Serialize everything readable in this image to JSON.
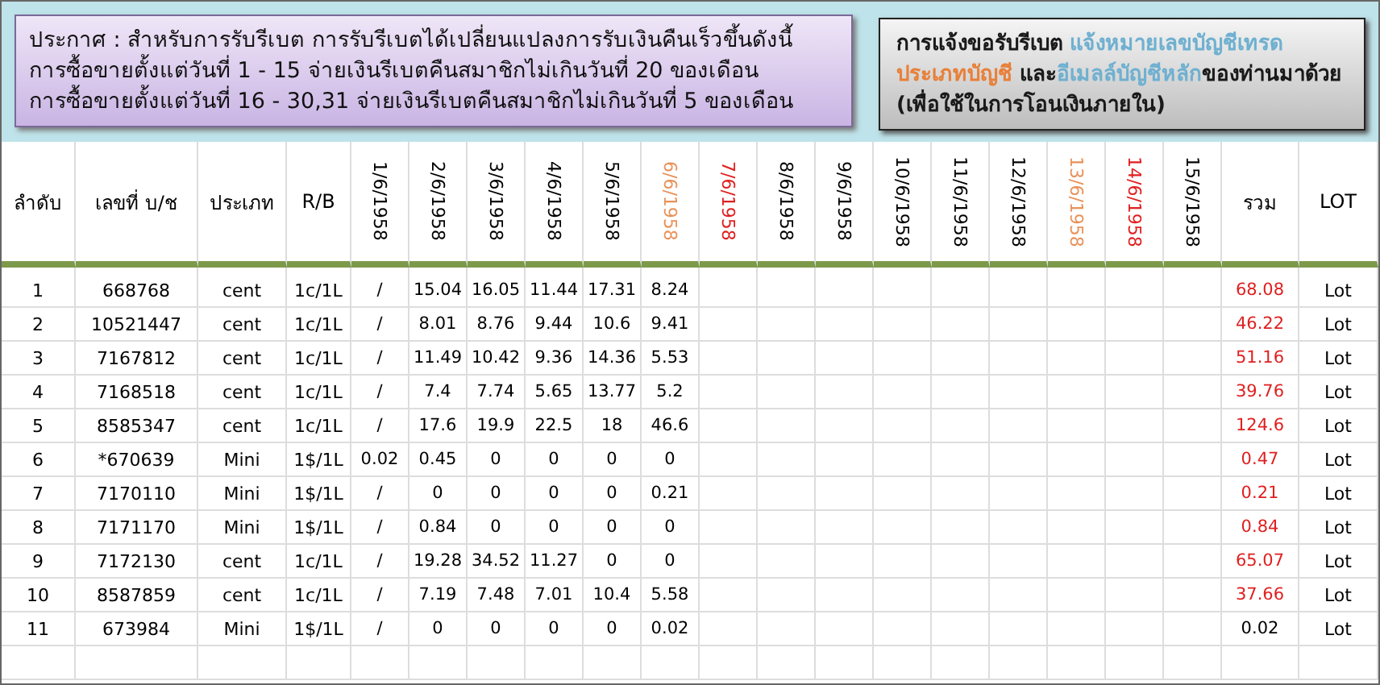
{
  "notice": {
    "lines": [
      "ประกาศ : สำหรับการรับรีเบต  การรับรีเบตได้เปลี่ยนแปลงการรับเงินคืนเร็วขึ้นดังนี้",
      "การซื้อขายตั้งแต่วันที่   1 - 15  จ่ายเงินรีเบตคืนสมาชิกไม่เกินวันที่ 20 ของเดือน",
      "การซื้อขายตั้งแต่วันที่ 16 - 30,31 จ่ายเงินรีเบตคืนสมาชิกไม่เกินวันที่  5  ของเดือน"
    ]
  },
  "request_note": {
    "segments": [
      {
        "text": "การแจ้งขอรับรีเบต  ",
        "color": "#1a1a1a"
      },
      {
        "text": "แจ้งหมายเลขบัญชีเทรด",
        "color": "#6fb0d0"
      },
      {
        "text": " ประเภทบัญชี",
        "color": "#e8803a"
      },
      {
        "text": " และ",
        "color": "#1a1a1a"
      },
      {
        "text": "อีเมลล์บัญชีหลัก",
        "color": "#6fb0d0"
      },
      {
        "text": "ของท่านมาด้วย   (เพื่อใช้ในการโอนเงินภายใน)",
        "color": "#1a1a1a"
      }
    ]
  },
  "table": {
    "columns": [
      "ลำดับ",
      "เลขที่ บ/ช",
      "ประเภท",
      "R/B"
    ],
    "date_columns": [
      {
        "label": "1/6/1958",
        "color": "#000000"
      },
      {
        "label": "2/6/1958",
        "color": "#000000"
      },
      {
        "label": "3/6/1958",
        "color": "#000000"
      },
      {
        "label": "4/6/1958",
        "color": "#000000"
      },
      {
        "label": "5/6/1958",
        "color": "#000000"
      },
      {
        "label": "6/6/1958",
        "color": "#e8925a"
      },
      {
        "label": "7/6/1958",
        "color": "#e02020"
      },
      {
        "label": "8/6/1958",
        "color": "#000000"
      },
      {
        "label": "9/6/1958",
        "color": "#000000"
      },
      {
        "label": "10/6/1958",
        "color": "#000000"
      },
      {
        "label": "11/6/1958",
        "color": "#000000"
      },
      {
        "label": "12/6/1958",
        "color": "#000000"
      },
      {
        "label": "13/6/1958",
        "color": "#e8925a"
      },
      {
        "label": "14/6/1958",
        "color": "#e02020"
      },
      {
        "label": "15/6/1958",
        "color": "#000000"
      }
    ],
    "total_column": "รวม",
    "lot_column": "LOT",
    "rows": [
      {
        "no": "1",
        "account": "668768",
        "type": "cent",
        "rb": "1c/1L",
        "values": [
          "/",
          "15.04",
          "16.05",
          "11.44",
          "17.31",
          "8.24"
        ],
        "total": {
          "text": "68.08",
          "color": "#e02020"
        },
        "lot": "Lot"
      },
      {
        "no": "2",
        "account": "10521447",
        "type": "cent",
        "rb": "1c/1L",
        "values": [
          "/",
          "8.01",
          "8.76",
          "9.44",
          "10.6",
          "9.41"
        ],
        "total": {
          "text": "46.22",
          "color": "#e02020"
        },
        "lot": "Lot"
      },
      {
        "no": "3",
        "account": "7167812",
        "type": "cent",
        "rb": "1c/1L",
        "values": [
          "/",
          "11.49",
          "10.42",
          "9.36",
          "14.36",
          "5.53"
        ],
        "total": {
          "text": "51.16",
          "color": "#e02020"
        },
        "lot": "Lot"
      },
      {
        "no": "4",
        "account": "7168518",
        "type": "cent",
        "rb": "1c/1L",
        "values": [
          "/",
          "7.4",
          "7.74",
          "5.65",
          "13.77",
          "5.2"
        ],
        "total": {
          "text": "39.76",
          "color": "#e02020"
        },
        "lot": "Lot"
      },
      {
        "no": "5",
        "account": "8585347",
        "type": "cent",
        "rb": "1c/1L",
        "values": [
          "/",
          "17.6",
          "19.9",
          "22.5",
          "18",
          "46.6"
        ],
        "total": {
          "text": "124.6",
          "color": "#e02020"
        },
        "lot": "Lot"
      },
      {
        "no": "6",
        "account": "*670639",
        "type": "Mini",
        "rb": "1$/1L",
        "values": [
          "0.02",
          "0.45",
          "0",
          "0",
          "0",
          "0"
        ],
        "total": {
          "text": "0.47",
          "color": "#e02020"
        },
        "lot": "Lot"
      },
      {
        "no": "7",
        "account": "7170110",
        "type": "Mini",
        "rb": "1$/1L",
        "values": [
          "/",
          "0",
          "0",
          "0",
          "0",
          "0.21"
        ],
        "total": {
          "text": "0.21",
          "color": "#e02020"
        },
        "lot": "Lot"
      },
      {
        "no": "8",
        "account": "7171170",
        "type": "Mini",
        "rb": "1$/1L",
        "values": [
          "/",
          "0.84",
          "0",
          "0",
          "0",
          "0"
        ],
        "total": {
          "text": "0.84",
          "color": "#e02020"
        },
        "lot": "Lot"
      },
      {
        "no": "9",
        "account": "7172130",
        "type": "cent",
        "rb": "1c/1L",
        "values": [
          "/",
          "19.28",
          "34.52",
          "11.27",
          "0",
          "0"
        ],
        "total": {
          "text": "65.07",
          "color": "#e02020"
        },
        "lot": "Lot"
      },
      {
        "no": "10",
        "account": "8587859",
        "type": "cent",
        "rb": "1c/1L",
        "values": [
          "/",
          "7.19",
          "7.48",
          "7.01",
          "10.4",
          "5.58"
        ],
        "total": {
          "text": "37.66",
          "color": "#e02020"
        },
        "lot": "Lot"
      },
      {
        "no": "11",
        "account": "673984",
        "type": "Mini",
        "rb": "1$/1L",
        "values": [
          "/",
          "0",
          "0",
          "0",
          "0",
          "0.02"
        ],
        "total": {
          "text": "0.02",
          "color": "#000000"
        },
        "lot": "Lot"
      }
    ]
  }
}
